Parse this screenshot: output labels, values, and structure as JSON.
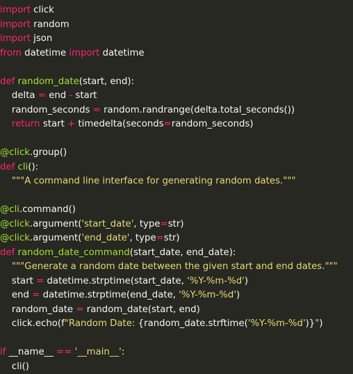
{
  "editor": {
    "lines": [
      [
        [
          "kw",
          "import"
        ],
        [
          "pl",
          " click"
        ]
      ],
      [
        [
          "kw",
          "import"
        ],
        [
          "pl",
          " random"
        ]
      ],
      [
        [
          "kw",
          "import"
        ],
        [
          "pl",
          " json"
        ]
      ],
      [
        [
          "kw",
          "from"
        ],
        [
          "pl",
          " datetime "
        ],
        [
          "kw",
          "import"
        ],
        [
          "pl",
          " datetime"
        ]
      ],
      [],
      [
        [
          "kw",
          "def"
        ],
        [
          "pl",
          " "
        ],
        [
          "fn",
          "random_date"
        ],
        [
          "pl",
          "(start, end):"
        ]
      ],
      [
        [
          "pl",
          "    delta "
        ],
        [
          "kw",
          "="
        ],
        [
          "pl",
          " end "
        ],
        [
          "kw",
          "-"
        ],
        [
          "pl",
          " start"
        ]
      ],
      [
        [
          "pl",
          "    random_seconds "
        ],
        [
          "kw",
          "="
        ],
        [
          "pl",
          " random.randrange(delta.total_seconds())"
        ]
      ],
      [
        [
          "pl",
          "    "
        ],
        [
          "kw",
          "return"
        ],
        [
          "pl",
          " start "
        ],
        [
          "kw",
          "+"
        ],
        [
          "pl",
          " timedelta(seconds"
        ],
        [
          "kw",
          "="
        ],
        [
          "pl",
          "random_seconds)"
        ]
      ],
      [],
      [
        [
          "fn",
          "@click"
        ],
        [
          "pl",
          ".group()"
        ]
      ],
      [
        [
          "kw",
          "def"
        ],
        [
          "pl",
          " "
        ],
        [
          "fn",
          "cli"
        ],
        [
          "pl",
          "():"
        ]
      ],
      [
        [
          "pl",
          "    "
        ],
        [
          "str",
          "\"\"\"A command line interface for generating random dates.\"\"\""
        ]
      ],
      [],
      [
        [
          "fn",
          "@cli"
        ],
        [
          "pl",
          ".command()"
        ]
      ],
      [
        [
          "fn",
          "@click"
        ],
        [
          "pl",
          ".argument("
        ],
        [
          "str",
          "'start_date'"
        ],
        [
          "pl",
          ", type"
        ],
        [
          "kw",
          "="
        ],
        [
          "pl",
          "str)"
        ]
      ],
      [
        [
          "fn",
          "@click"
        ],
        [
          "pl",
          ".argument("
        ],
        [
          "str",
          "'end_date'"
        ],
        [
          "pl",
          ", type"
        ],
        [
          "kw",
          "="
        ],
        [
          "pl",
          "str)"
        ]
      ],
      [
        [
          "kw",
          "def"
        ],
        [
          "pl",
          " "
        ],
        [
          "fn",
          "random_date_command"
        ],
        [
          "pl",
          "(start_date, end_date):"
        ]
      ],
      [
        [
          "pl",
          "    "
        ],
        [
          "str",
          "\"\"\"Generate a random date between the given start and end dates.\"\"\""
        ]
      ],
      [
        [
          "pl",
          "    start "
        ],
        [
          "kw",
          "="
        ],
        [
          "pl",
          " datetime.strptime(start_date, "
        ],
        [
          "str",
          "'%Y-%m-%d'"
        ],
        [
          "pl",
          ")"
        ]
      ],
      [
        [
          "pl",
          "    end "
        ],
        [
          "kw",
          "="
        ],
        [
          "pl",
          " datetime.strptime(end_date, "
        ],
        [
          "str",
          "'%Y-%m-%d'"
        ],
        [
          "pl",
          ")"
        ]
      ],
      [
        [
          "pl",
          "    random_date "
        ],
        [
          "kw",
          "="
        ],
        [
          "pl",
          " random_date(start, end)"
        ]
      ],
      [
        [
          "pl",
          "    click.echo(f"
        ],
        [
          "str",
          "\"Random Date: "
        ],
        [
          "pl",
          "{random_date.strftime("
        ],
        [
          "str",
          "'%Y-%m-%d'"
        ],
        [
          "pl",
          ")}"
        ],
        [
          "str",
          "\""
        ],
        [
          "pl",
          ")"
        ]
      ],
      [],
      [
        [
          "kw",
          "if"
        ],
        [
          "pl",
          " __name__ "
        ],
        [
          "kw",
          "=="
        ],
        [
          "pl",
          " "
        ],
        [
          "str",
          "'__main__'"
        ],
        [
          "pl",
          ":"
        ]
      ],
      [
        [
          "pl",
          "    cli()"
        ]
      ]
    ]
  }
}
